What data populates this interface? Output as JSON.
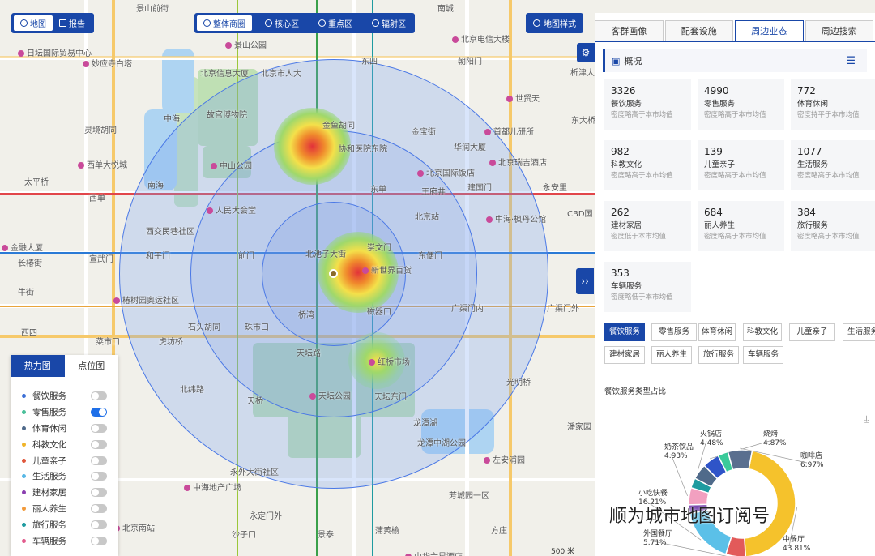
{
  "view_toggle": [
    {
      "label": "地图",
      "active": true
    },
    {
      "label": "报告",
      "active": false
    }
  ],
  "area_tabs": [
    {
      "label": "整体商圈",
      "active": true
    },
    {
      "label": "核心区",
      "active": false
    },
    {
      "label": "重点区",
      "active": false
    },
    {
      "label": "辐射区",
      "active": false
    }
  ],
  "map_style_label": "地图样式",
  "map_labels": [
    {
      "text": "北京电信大楼",
      "poi": true
    },
    {
      "text": "东四",
      "poi": false
    },
    {
      "text": "朝阳门",
      "poi": false
    },
    {
      "text": "金鱼胡同",
      "poi": false
    },
    {
      "text": "协和医院东院",
      "poi": false
    },
    {
      "text": "金宝街",
      "poi": false
    },
    {
      "text": "首都儿研所",
      "poi": true
    },
    {
      "text": "华润大厦",
      "poi": false
    },
    {
      "text": "北京国际饭店",
      "poi": true
    },
    {
      "text": "北京瑞吉酒店",
      "poi": true
    },
    {
      "text": "王府井",
      "poi": false
    },
    {
      "text": "东单",
      "poi": false
    },
    {
      "text": "建国门",
      "poi": false
    },
    {
      "text": "永安里",
      "poi": false
    },
    {
      "text": "北京站",
      "poi": false
    },
    {
      "text": "中海·枫丹公馆",
      "poi": true
    },
    {
      "text": "CBD国",
      "poi": false
    },
    {
      "text": "人民大会堂",
      "poi": true
    },
    {
      "text": "西交民巷社区",
      "poi": false
    },
    {
      "text": "和平门",
      "poi": false
    },
    {
      "text": "前门",
      "poi": false
    },
    {
      "text": "崇文门",
      "poi": false
    },
    {
      "text": "东便门",
      "poi": false
    },
    {
      "text": "新世界百货",
      "poi": true
    },
    {
      "text": "宣武门",
      "poi": false
    },
    {
      "text": "椿树园奥运社区",
      "poi": true
    },
    {
      "text": "桥湾",
      "poi": false
    },
    {
      "text": "磁器口",
      "poi": false
    },
    {
      "text": "广渠门内",
      "poi": false
    },
    {
      "text": "广渠门外",
      "poi": false
    },
    {
      "text": "石头胡同",
      "poi": false
    },
    {
      "text": "珠市口",
      "poi": false
    },
    {
      "text": "虎坊桥",
      "poi": false
    },
    {
      "text": "菜市口",
      "poi": false
    },
    {
      "text": "天坛路",
      "poi": false
    },
    {
      "text": "红桥市场",
      "poi": true
    },
    {
      "text": "天坛公园",
      "poi": true
    },
    {
      "text": "天坛东门",
      "poi": false
    },
    {
      "text": "光明桥",
      "poi": false
    },
    {
      "text": "北纬路",
      "poi": false
    },
    {
      "text": "天桥",
      "poi": false
    },
    {
      "text": "龙潭湖",
      "poi": false
    },
    {
      "text": "龙潭中湖公园",
      "poi": false
    },
    {
      "text": "左安浦园",
      "poi": true
    },
    {
      "text": "潘家园",
      "poi": false
    },
    {
      "text": "永外大街社区",
      "poi": false
    },
    {
      "text": "中海地产广场",
      "poi": true
    },
    {
      "text": "永定门外",
      "poi": false
    },
    {
      "text": "北京南站",
      "poi": true
    },
    {
      "text": "芳城园一区",
      "poi": false
    },
    {
      "text": "景泰",
      "poi": false
    },
    {
      "text": "蒲黄榆",
      "poi": false
    },
    {
      "text": "方庄",
      "poi": false
    },
    {
      "text": "沙子口",
      "poi": false
    },
    {
      "text": "中华六星酒店",
      "poi": true
    },
    {
      "text": "故宫博物院",
      "poi": false
    },
    {
      "text": "景山公园",
      "poi": true
    },
    {
      "text": "中山公园",
      "poi": true
    },
    {
      "text": "中海",
      "poi": false
    },
    {
      "text": "南海",
      "poi": false
    },
    {
      "text": "西单",
      "poi": false
    },
    {
      "text": "西单大悦城",
      "poi": true
    },
    {
      "text": "灵境胡同",
      "poi": false
    },
    {
      "text": "太平桥",
      "poi": false
    },
    {
      "text": "金融大厦",
      "poi": true
    },
    {
      "text": "长椿街",
      "poi": false
    },
    {
      "text": "牛街",
      "poi": false
    },
    {
      "text": "西四",
      "poi": false
    },
    {
      "text": "妙应寺白塔",
      "poi": true
    },
    {
      "text": "日坛国际贸易中心",
      "poi": true
    },
    {
      "text": "世贸天",
      "poi": true
    },
    {
      "text": "东大桥",
      "poi": false
    },
    {
      "text": "析津大街",
      "poi": false
    },
    {
      "text": "北池子大街",
      "poi": false
    },
    {
      "text": "北京市人大",
      "poi": false
    },
    {
      "text": "南城",
      "poi": false
    },
    {
      "text": "景山前街",
      "poi": false
    },
    {
      "text": "北京信息大厦",
      "poi": false
    }
  ],
  "legend": {
    "tabs": [
      {
        "label": "热力图",
        "active": true
      },
      {
        "label": "点位图",
        "active": false
      }
    ],
    "items": [
      {
        "label": "餐饮服务",
        "color": "#3c6fd6",
        "on": false
      },
      {
        "label": "零售服务",
        "color": "#4ac09a",
        "on": true
      },
      {
        "label": "体育休闲",
        "color": "#4f6a8a",
        "on": false
      },
      {
        "label": "科教文化",
        "color": "#f0b429",
        "on": false
      },
      {
        "label": "儿童亲子",
        "color": "#e0573c",
        "on": false
      },
      {
        "label": "生活服务",
        "color": "#58b8e6",
        "on": false
      },
      {
        "label": "建材家居",
        "color": "#8a3fb0",
        "on": false
      },
      {
        "label": "丽人养生",
        "color": "#f29a3b",
        "on": false
      },
      {
        "label": "旅行服务",
        "color": "#1e9ba0",
        "on": false
      },
      {
        "label": "车辆服务",
        "color": "#e25b8d",
        "on": false
      }
    ]
  },
  "panel": {
    "tabs": [
      {
        "label": "客群画像",
        "active": false
      },
      {
        "label": "配套设施",
        "active": false
      },
      {
        "label": "周边业态",
        "active": true
      },
      {
        "label": "周边搜索",
        "active": false
      }
    ],
    "overview_title": "概况",
    "cards": [
      {
        "num": "3326",
        "name": "餐饮服务",
        "desc": "密度略高于本市均值"
      },
      {
        "num": "4990",
        "name": "零售服务",
        "desc": "密度略高于本市均值"
      },
      {
        "num": "772",
        "name": "体育休闲",
        "desc": "密度持平于本市均值"
      },
      {
        "num": "982",
        "name": "科教文化",
        "desc": "密度略高于本市均值"
      },
      {
        "num": "139",
        "name": "儿童亲子",
        "desc": "密度略高于本市均值"
      },
      {
        "num": "1077",
        "name": "生活服务",
        "desc": "密度略高于本市均值"
      },
      {
        "num": "262",
        "name": "建材家居",
        "desc": "密度低于本市均值"
      },
      {
        "num": "684",
        "name": "丽人养生",
        "desc": "密度略高于本市均值"
      },
      {
        "num": "384",
        "name": "旅行服务",
        "desc": "密度略高于本市均值"
      },
      {
        "num": "353",
        "name": "车辆服务",
        "desc": "密度略低于本市均值"
      }
    ],
    "chips": [
      {
        "label": "餐饮服务",
        "active": true
      },
      {
        "label": "零售服务",
        "active": false
      },
      {
        "label": "体育休闲",
        "active": false
      },
      {
        "label": "科教文化",
        "active": false
      },
      {
        "label": "儿童亲子",
        "active": false
      },
      {
        "label": "生活服务",
        "active": false
      },
      {
        "label": "建材家居",
        "active": false
      },
      {
        "label": "丽人养生",
        "active": false
      },
      {
        "label": "旅行服务",
        "active": false
      },
      {
        "label": "车辆服务",
        "active": false
      }
    ],
    "chart_title": "餐饮服务类型占比"
  },
  "chart_data": {
    "type": "pie",
    "title": "餐饮服务类型占比",
    "slices": [
      {
        "label": "中餐厅",
        "value": 43.81,
        "pct_label": "43.81%",
        "color": "#f5c22c"
      },
      {
        "label": "外国餐厅",
        "value": 5.71,
        "pct_label": "5.71%",
        "color": "#e25a5a"
      },
      {
        "label": "小吃快餐",
        "value": 16.21,
        "pct_label": "16.21%",
        "color": "#5bc0e8"
      },
      {
        "label": "",
        "value": 2.5,
        "pct_label": "",
        "color": "#7b4ab0"
      },
      {
        "label": "奶茶饮品",
        "value": 4.93,
        "pct_label": "4.93%",
        "color": "#f2a0c0"
      },
      {
        "label": "",
        "value": 2.9,
        "pct_label": "",
        "color": "#1e9ba0"
      },
      {
        "label": "火锅店",
        "value": 4.48,
        "pct_label": "4.48%",
        "color": "#4f6a8a"
      },
      {
        "label": "烧烤",
        "value": 4.87,
        "pct_label": "4.87%",
        "color": "#2f54c8"
      },
      {
        "label": "",
        "value": 3.0,
        "pct_label": "",
        "color": "#3aca9a"
      },
      {
        "label": "咖啡店",
        "value": 6.97,
        "pct_label": "6.97%",
        "color": "#5a6f8f"
      }
    ]
  },
  "scale_label": "500 米",
  "watermark": "顺为城市地图订阅号"
}
